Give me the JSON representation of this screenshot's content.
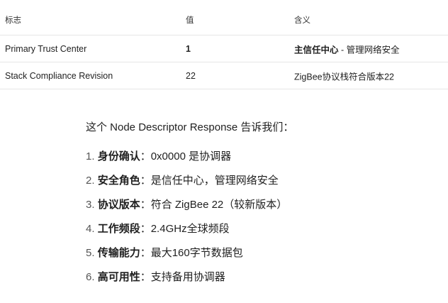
{
  "table": {
    "headers": [
      "标志",
      "值",
      "含义"
    ],
    "rows": [
      {
        "flag": "Primary Trust Center",
        "value": "1",
        "meaning_strong": "主信任中心",
        "meaning_rest": " - 管理网络安全"
      },
      {
        "flag": "Stack Compliance Revision",
        "value": "22",
        "meaning_strong": "",
        "meaning_rest": "ZigBee协议栈符合版本22"
      }
    ]
  },
  "intro": "这个 Node Descriptor Response 告诉我们：",
  "list": [
    {
      "num": "1.",
      "term": "身份确认",
      "sep": "：",
      "desc": "0x0000 是协调器"
    },
    {
      "num": "2.",
      "term": "安全角色",
      "sep": "：",
      "desc": "是信任中心，管理网络安全"
    },
    {
      "num": "3.",
      "term": "协议版本",
      "sep": "：",
      "desc": "符合 ZigBee 22（较新版本）"
    },
    {
      "num": "4.",
      "term": "工作频段",
      "sep": "：",
      "desc": "2.4GHz全球频段"
    },
    {
      "num": "5.",
      "term": "传输能力",
      "sep": "：",
      "desc": "最大160字节数据包"
    },
    {
      "num": "6.",
      "term": "高可用性",
      "sep": "：",
      "desc": "支持备用协调器"
    }
  ]
}
